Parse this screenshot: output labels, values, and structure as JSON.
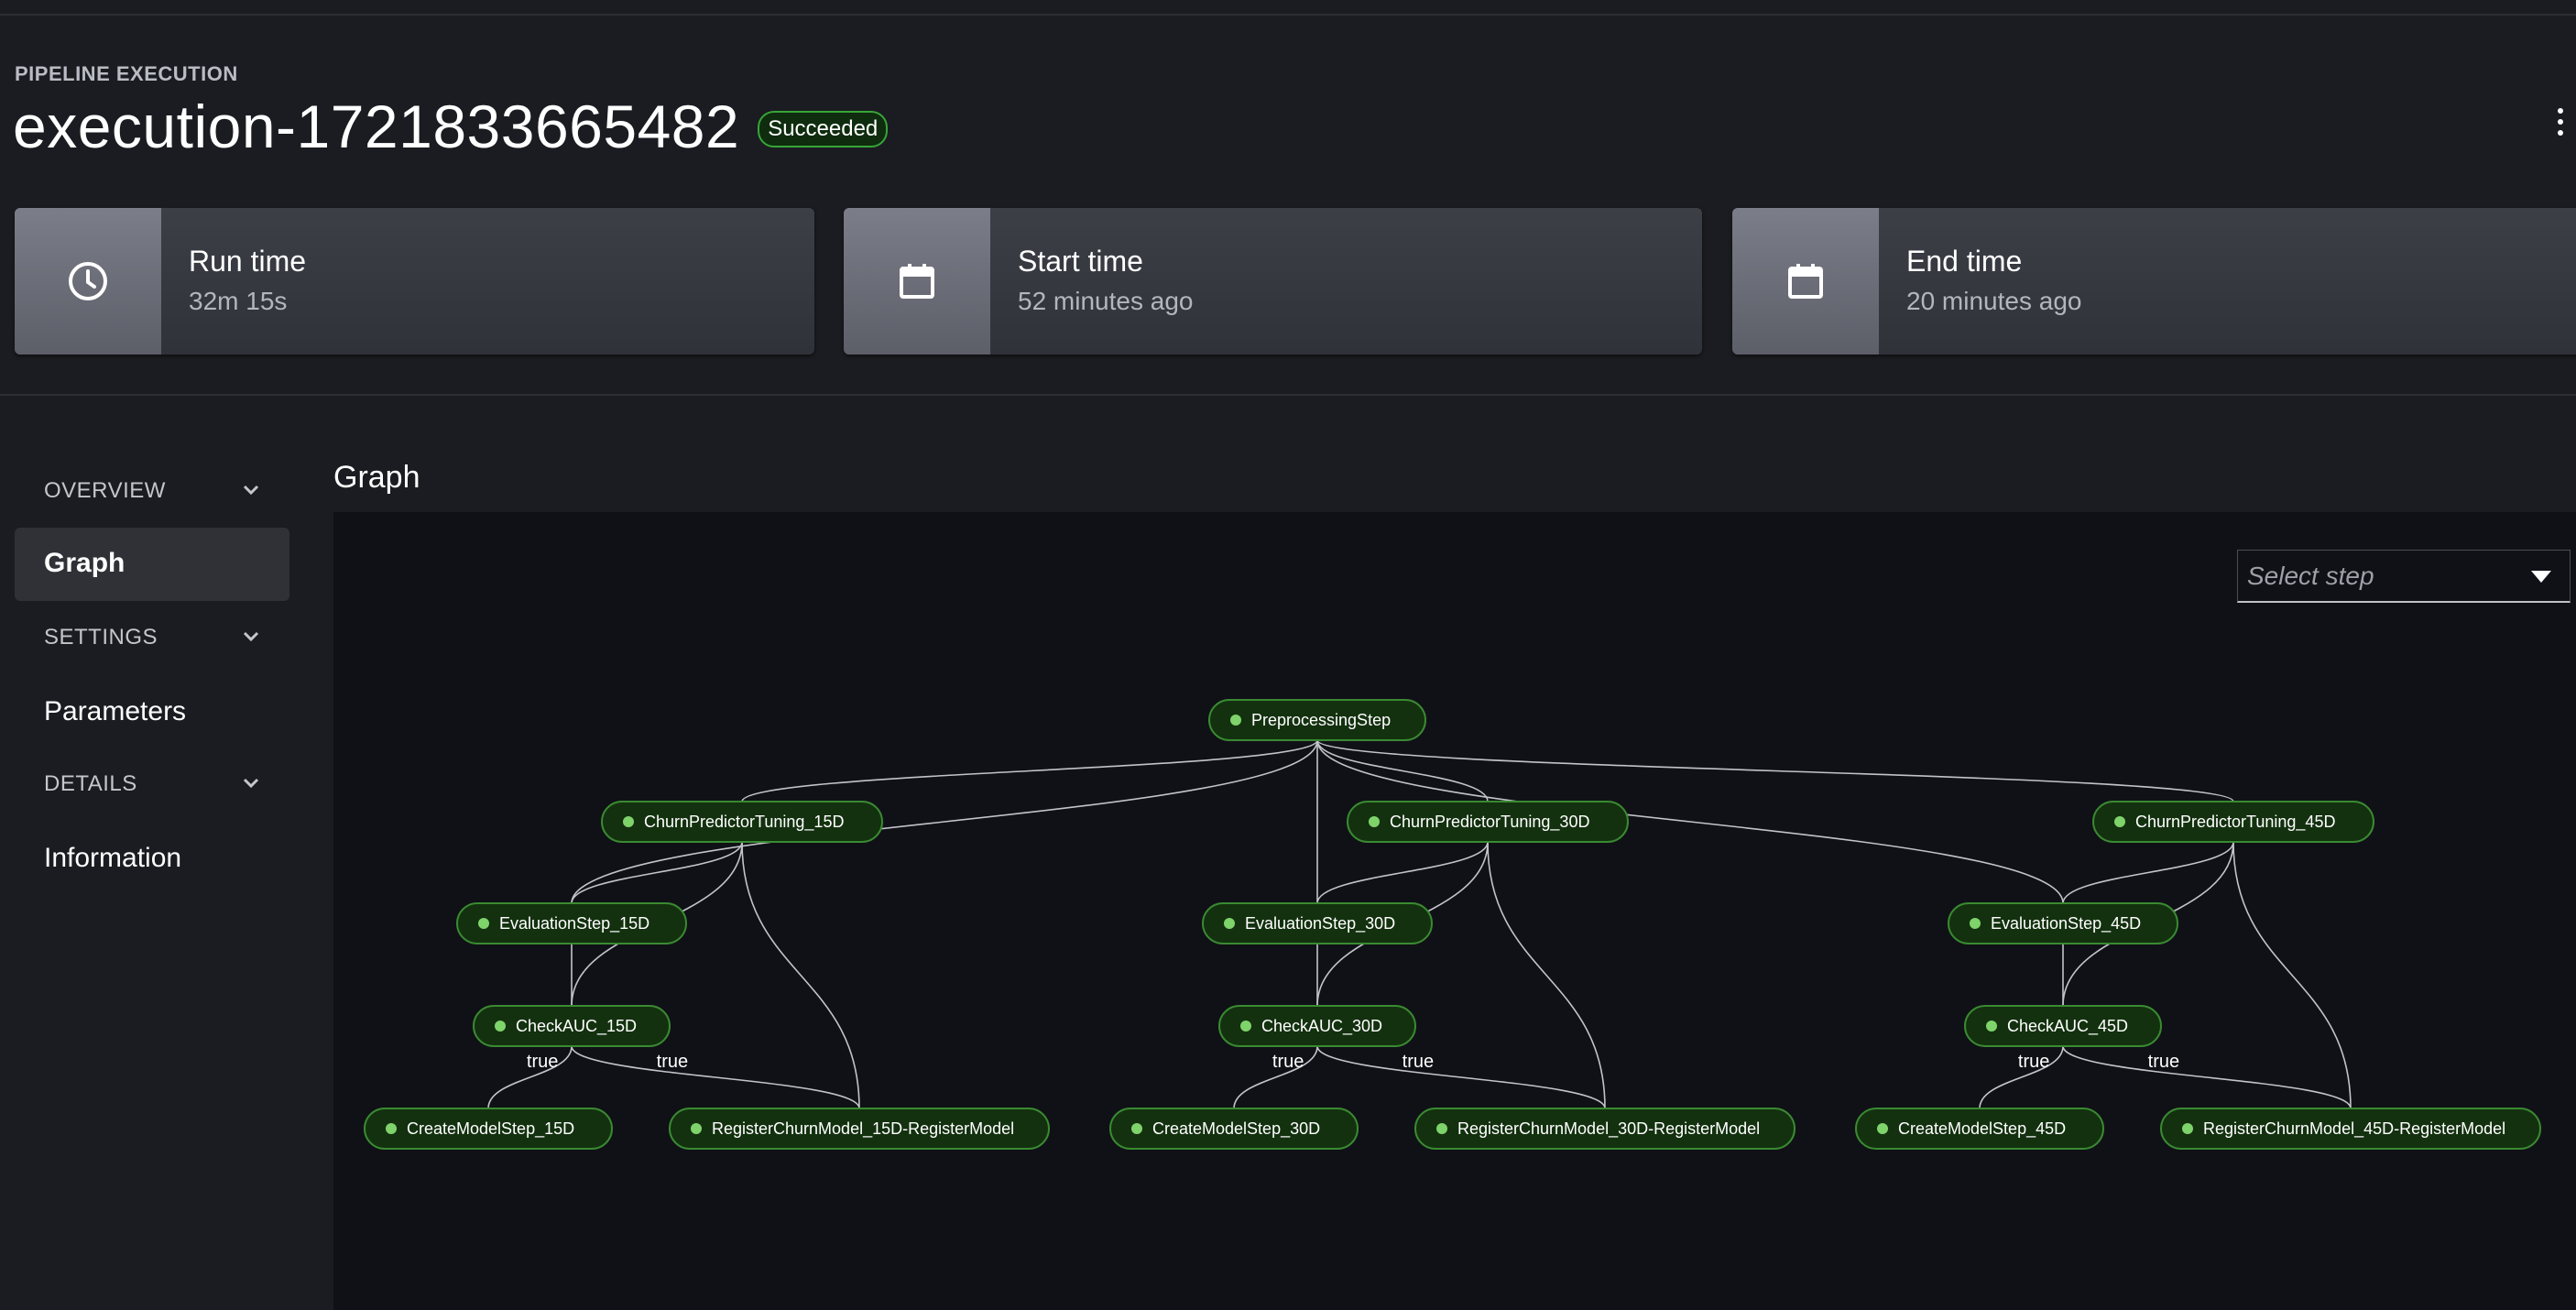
{
  "header": {
    "section_label": "PIPELINE EXECUTION",
    "title": "execution-1721833665482",
    "status": "Succeeded",
    "more_icon": "kebab-vertical-icon"
  },
  "summary_cards": [
    {
      "label": "Run time",
      "value": "32m 15s",
      "icon": "clock-icon"
    },
    {
      "label": "Start time",
      "value": "52 minutes ago",
      "icon": "calendar-icon"
    },
    {
      "label": "End time",
      "value": "20 minutes ago",
      "icon": "calendar-icon"
    }
  ],
  "sidebar": {
    "sections": [
      {
        "label": "OVERVIEW",
        "items": [
          "Graph"
        ]
      },
      {
        "label": "SETTINGS",
        "items": [
          "Parameters"
        ]
      },
      {
        "label": "DETAILS",
        "items": [
          "Information"
        ]
      }
    ],
    "active_item": "Graph"
  },
  "graph": {
    "heading": "Graph",
    "select_placeholder": "Select step",
    "status_color": "#7fd36b",
    "nodes": [
      {
        "id": "pre",
        "label": "PreprocessingStep"
      },
      {
        "id": "t15",
        "label": "ChurnPredictorTuning_15D"
      },
      {
        "id": "t30",
        "label": "ChurnPredictorTuning_30D"
      },
      {
        "id": "t45",
        "label": "ChurnPredictorTuning_45D"
      },
      {
        "id": "e15",
        "label": "EvaluationStep_15D"
      },
      {
        "id": "e30",
        "label": "EvaluationStep_30D"
      },
      {
        "id": "e45",
        "label": "EvaluationStep_45D"
      },
      {
        "id": "c15",
        "label": "CheckAUC_15D"
      },
      {
        "id": "c30",
        "label": "CheckAUC_30D"
      },
      {
        "id": "c45",
        "label": "CheckAUC_45D"
      },
      {
        "id": "cm15",
        "label": "CreateModelStep_15D"
      },
      {
        "id": "cm30",
        "label": "CreateModelStep_30D"
      },
      {
        "id": "cm45",
        "label": "CreateModelStep_45D"
      },
      {
        "id": "r15",
        "label": "RegisterChurnModel_15D-RegisterModel"
      },
      {
        "id": "r30",
        "label": "RegisterChurnModel_30D-RegisterModel"
      },
      {
        "id": "r45",
        "label": "RegisterChurnModel_45D-RegisterModel"
      }
    ],
    "edges": [
      {
        "from": "pre",
        "to": "t15"
      },
      {
        "from": "pre",
        "to": "t30"
      },
      {
        "from": "pre",
        "to": "t45"
      },
      {
        "from": "pre",
        "to": "e15"
      },
      {
        "from": "pre",
        "to": "e30"
      },
      {
        "from": "pre",
        "to": "e45"
      },
      {
        "from": "t15",
        "to": "e15"
      },
      {
        "from": "t15",
        "to": "c15"
      },
      {
        "from": "t15",
        "to": "r15"
      },
      {
        "from": "t30",
        "to": "e30"
      },
      {
        "from": "t30",
        "to": "c30"
      },
      {
        "from": "t30",
        "to": "r30"
      },
      {
        "from": "t45",
        "to": "e45"
      },
      {
        "from": "t45",
        "to": "c45"
      },
      {
        "from": "t45",
        "to": "r45"
      },
      {
        "from": "e15",
        "to": "c15"
      },
      {
        "from": "e30",
        "to": "c30"
      },
      {
        "from": "e45",
        "to": "c45"
      },
      {
        "from": "c15",
        "to": "cm15",
        "label": "true"
      },
      {
        "from": "c15",
        "to": "r15",
        "label": "true"
      },
      {
        "from": "c30",
        "to": "cm30",
        "label": "true"
      },
      {
        "from": "c30",
        "to": "r30",
        "label": "true"
      },
      {
        "from": "c45",
        "to": "cm45",
        "label": "true"
      },
      {
        "from": "c45",
        "to": "r45",
        "label": "true"
      }
    ]
  }
}
